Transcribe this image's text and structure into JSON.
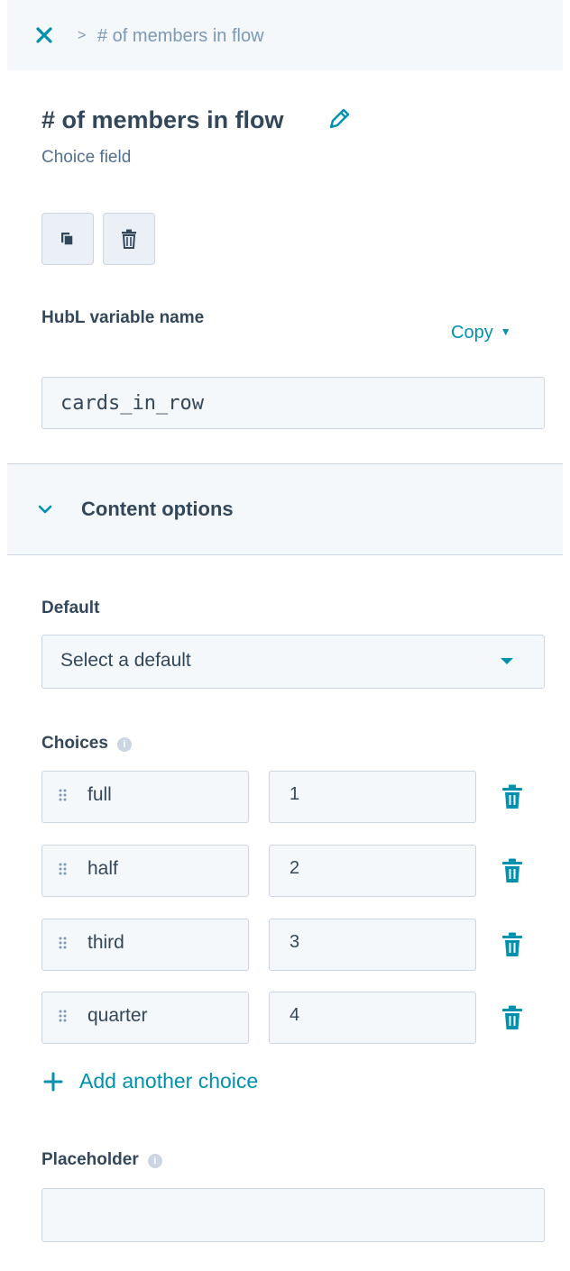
{
  "breadcrumb": {
    "separator": ">",
    "current": "# of members in flow"
  },
  "field": {
    "title": "# of members in flow",
    "type": "Choice field"
  },
  "hubl": {
    "label": "HubL variable name",
    "copy_label": "Copy",
    "value": "cards_in_row"
  },
  "section": {
    "title": "Content options"
  },
  "default": {
    "label": "Default",
    "selected": "Select a default"
  },
  "choices": {
    "label": "Choices",
    "items": [
      {
        "label": "full",
        "value": "1"
      },
      {
        "label": "half",
        "value": "2"
      },
      {
        "label": "third",
        "value": "3"
      },
      {
        "label": "quarter",
        "value": "4"
      }
    ],
    "add_label": "Add another choice"
  },
  "placeholder": {
    "label": "Placeholder",
    "value": ""
  },
  "colors": {
    "accent": "#0091ae",
    "text": "#33475b",
    "muted": "#7c98b6",
    "input_bg": "#f5f8fa",
    "border": "#cbd6e2"
  }
}
